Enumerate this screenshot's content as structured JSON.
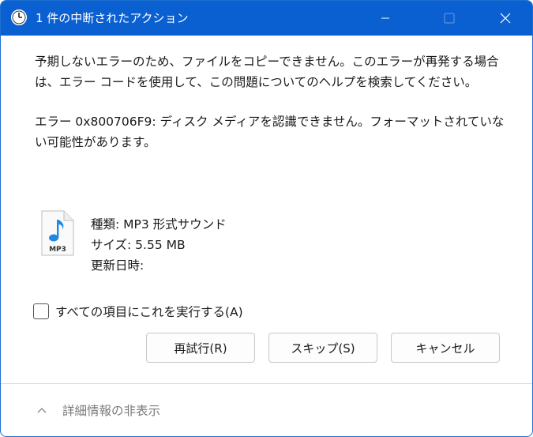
{
  "window": {
    "title": "1 件の中断されたアクション",
    "accent": "#0a5fd1"
  },
  "message": {
    "line1": "予期しないエラーのため、ファイルをコピーできません。このエラーが再発する場合は、エラー コードを使用して、この問題についてのヘルプを検索してください。",
    "line2": "エラー 0x800706F9: ディスク メディアを認識できません。フォーマットされていない可能性があります。"
  },
  "file": {
    "icon_label": "MP3",
    "type": "種類: MP3 形式サウンド",
    "size": "サイズ: 5.55 MB",
    "modified": "更新日時:"
  },
  "apply_all": {
    "label": "すべての項目にこれを実行する(A)",
    "checked": false
  },
  "buttons": {
    "retry": "再試行(R)",
    "skip": "スキップ(S)",
    "cancel": "キャンセル"
  },
  "details": {
    "label": "詳細情報の非表示",
    "icon": "chevron-up-icon"
  }
}
